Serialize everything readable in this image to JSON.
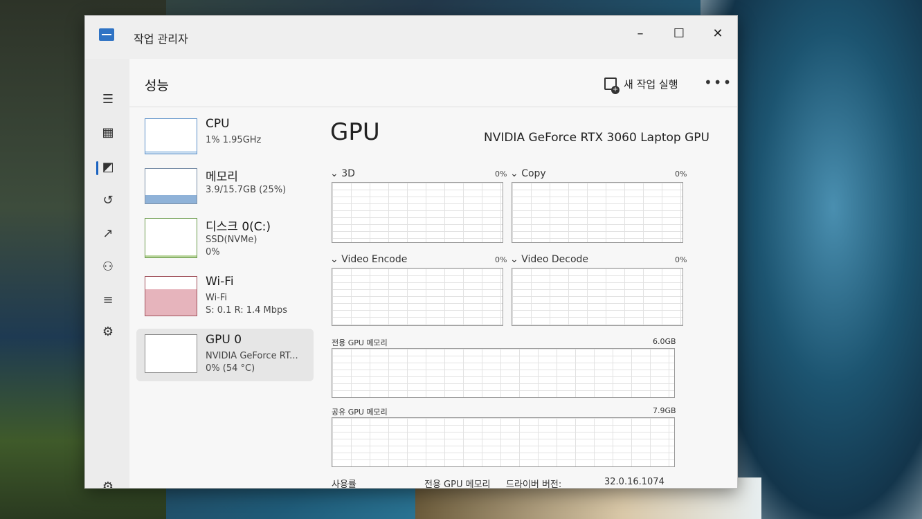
{
  "window": {
    "title": "작업 관리자",
    "minimize": "–",
    "maximize": "☐",
    "close": "✕"
  },
  "header": {
    "title": "성능",
    "run_task_label": "새 작업 실행",
    "more": "•••"
  },
  "nav": {
    "items": [
      {
        "name": "menu-icon",
        "glyph": "☰"
      },
      {
        "name": "processes-icon",
        "glyph": "▦"
      },
      {
        "name": "performance-icon",
        "glyph": "◩"
      },
      {
        "name": "app-history-icon",
        "glyph": "↺"
      },
      {
        "name": "startup-apps-icon",
        "glyph": "↗"
      },
      {
        "name": "users-icon",
        "glyph": "⚇"
      },
      {
        "name": "details-icon",
        "glyph": "≡"
      },
      {
        "name": "services-icon",
        "glyph": "⚙"
      }
    ],
    "settings_glyph": "⚙"
  },
  "resources": [
    {
      "name": "CPU",
      "line1": "1% 1.95GHz",
      "line2": ""
    },
    {
      "name": "메모리",
      "line1": "3.9/15.7GB (25%)",
      "line2": ""
    },
    {
      "name": "디스크 0(C:)",
      "line1": "SSD(NVMe)",
      "line2": "0%"
    },
    {
      "name": "Wi-Fi",
      "line1": "Wi-Fi",
      "line2": "S: 0.1 R: 1.4 Mbps"
    },
    {
      "name": "GPU 0",
      "line1": "NVIDIA GeForce RT...",
      "line2": "0% (54 °C)"
    }
  ],
  "gpu": {
    "title": "GPU",
    "model": "NVIDIA GeForce RTX 3060 Laptop GPU",
    "engines": [
      {
        "label": "3D",
        "pct": "0%"
      },
      {
        "label": "Copy",
        "pct": "0%"
      },
      {
        "label": "Video Encode",
        "pct": "0%"
      },
      {
        "label": "Video Decode",
        "pct": "0%"
      }
    ],
    "dedicated_label": "전용 GPU 메모리",
    "dedicated_max": "6.0GB",
    "shared_label": "공유 GPU 메모리",
    "shared_max": "7.9GB",
    "footer": {
      "usage_label": "사용률",
      "dedicated_label": "전용 GPU 메모리",
      "driver_label": "드라이버 버전:",
      "driver_value": "32.0.16.1074"
    }
  }
}
